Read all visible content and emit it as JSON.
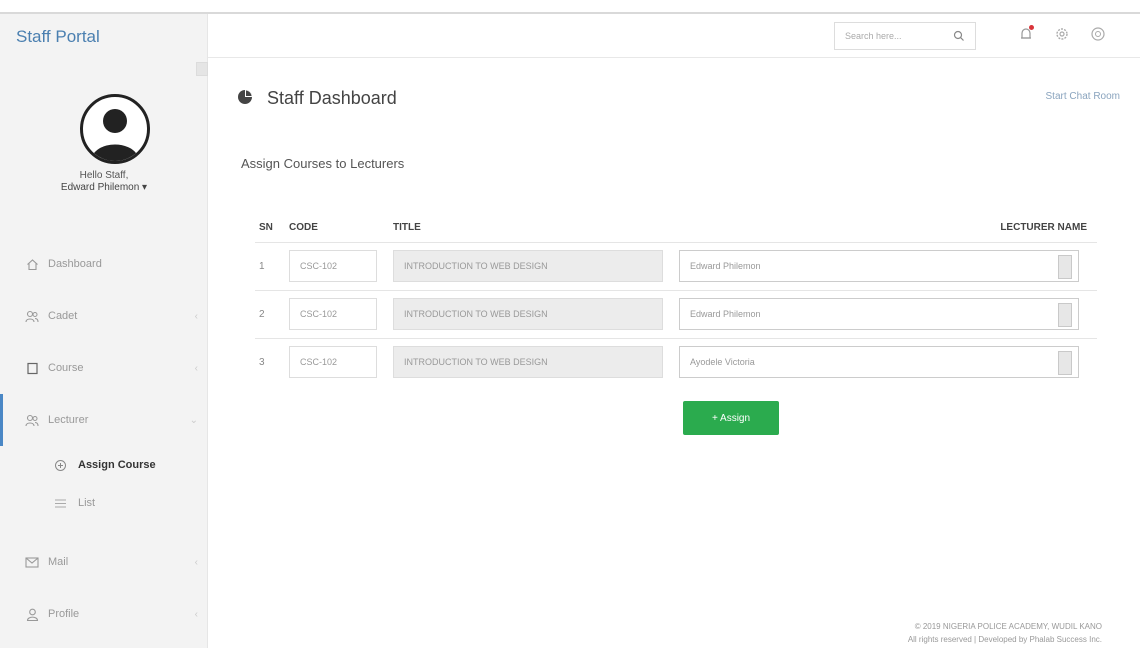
{
  "header": {
    "brand": "Staff Portal",
    "search_placeholder": "Search here...",
    "icons": [
      "search-icon",
      "notification-icon",
      "settings-icon",
      "help-icon"
    ],
    "notification_dot_color": "#d9343a"
  },
  "sidebar": {
    "greeting": "Hello Staff,",
    "user_name": "Edward Philemon ▾",
    "items": [
      {
        "label": "Dashboard",
        "icon": "home-icon"
      },
      {
        "label": "Cadet",
        "icon": "users-icon"
      },
      {
        "label": "Course",
        "icon": "book-icon"
      },
      {
        "label": "Lecturer",
        "icon": "users-icon"
      },
      {
        "label": "Mail",
        "icon": "mail-icon"
      },
      {
        "label": "Profile",
        "icon": "user-icon"
      }
    ],
    "lecturer_subitems": [
      {
        "label": "Assign Course",
        "icon": "plus-circle-icon"
      },
      {
        "label": "List",
        "icon": "list-icon"
      }
    ],
    "active_color": "#4a87c5"
  },
  "main": {
    "page_title": "Staff Dashboard",
    "chat_link": "Start Chat Room",
    "section_title": "Assign Courses to Lecturers",
    "table": {
      "headers": {
        "sn": "SN",
        "code": "CODE",
        "title": "TITLE",
        "lecturer": "LECTURER NAME"
      },
      "rows": [
        {
          "sn": "1",
          "code": "CSC-102",
          "title": "INTRODUCTION TO WEB DESIGN",
          "lecturer": "Edward Philemon"
        },
        {
          "sn": "2",
          "code": "CSC-102",
          "title": "INTRODUCTION TO WEB DESIGN",
          "lecturer": "Edward Philemon"
        },
        {
          "sn": "3",
          "code": "CSC-102",
          "title": "INTRODUCTION TO WEB DESIGN",
          "lecturer": "Ayodele Victoria"
        }
      ]
    },
    "assign_button": "+ Assign",
    "assign_color": "#2bab4e"
  },
  "footer": {
    "line1": "© 2019 NIGERIA POLICE ACADEMY, WUDIL KANO",
    "line2": "All rights reserved | Developed by Phalab Success Inc."
  }
}
